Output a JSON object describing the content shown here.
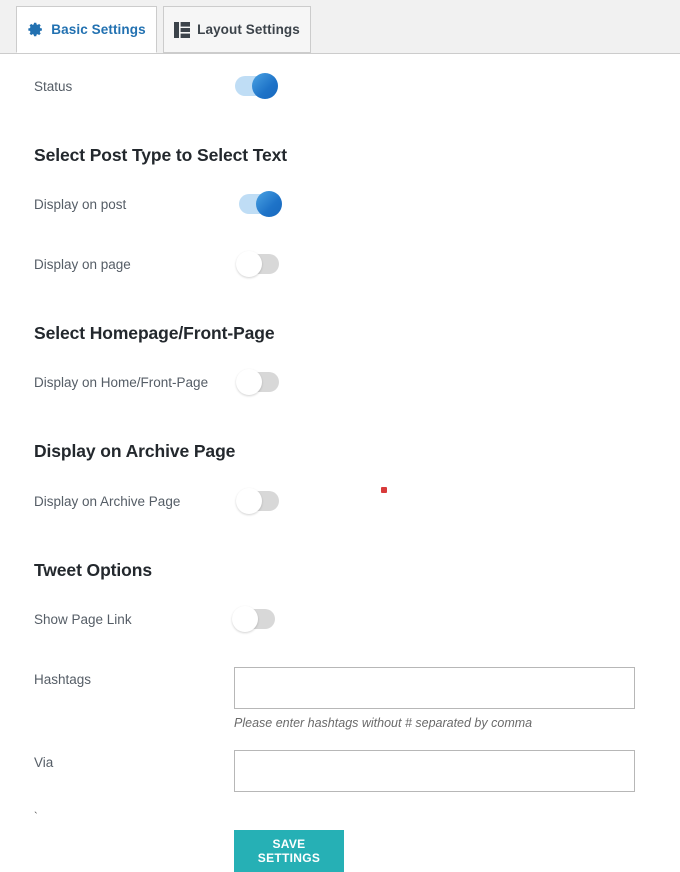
{
  "tabs": [
    {
      "label": "Basic Settings",
      "icon": "gear-icon",
      "active": true
    },
    {
      "label": "Layout Settings",
      "icon": "layout-grid-icon",
      "active": false
    }
  ],
  "rows": {
    "status": {
      "label": "Status",
      "state": "on"
    },
    "display_on_post": {
      "label": "Display on post",
      "state": "on"
    },
    "display_on_page": {
      "label": "Display on page",
      "state": "off"
    },
    "display_on_home": {
      "label": "Display on Home/Front-Page",
      "state": "off"
    },
    "display_on_archive": {
      "label": "Display on Archive Page",
      "state": "off"
    },
    "show_page_link": {
      "label": "Show Page Link",
      "state": "off"
    }
  },
  "headings": {
    "post_type": "Select Post Type to Select Text",
    "homepage": "Select Homepage/Front-Page",
    "archive": "Display on Archive Page",
    "tweet_options": "Tweet Options"
  },
  "fields": {
    "hashtags": {
      "label": "Hashtags",
      "value": "",
      "placeholder": "",
      "helper": "Please enter hashtags without # separated by comma"
    },
    "via": {
      "label": "Via",
      "value": "",
      "placeholder": ""
    }
  },
  "actions": {
    "save_label": "SAVE SETTINGS"
  },
  "marks": {
    "cursor_dot": "·",
    "stray_tick": "`"
  },
  "colors": {
    "tab_active_text": "#2271b1",
    "tab_inactive_text": "#3c434a",
    "toggle_on_track": "#bfddf5",
    "toggle_on_knob": "#1e73c8",
    "toggle_off_track": "#d8d8d8",
    "save_button": "#26b0b5",
    "cursor_dot": "#d83b3b"
  }
}
